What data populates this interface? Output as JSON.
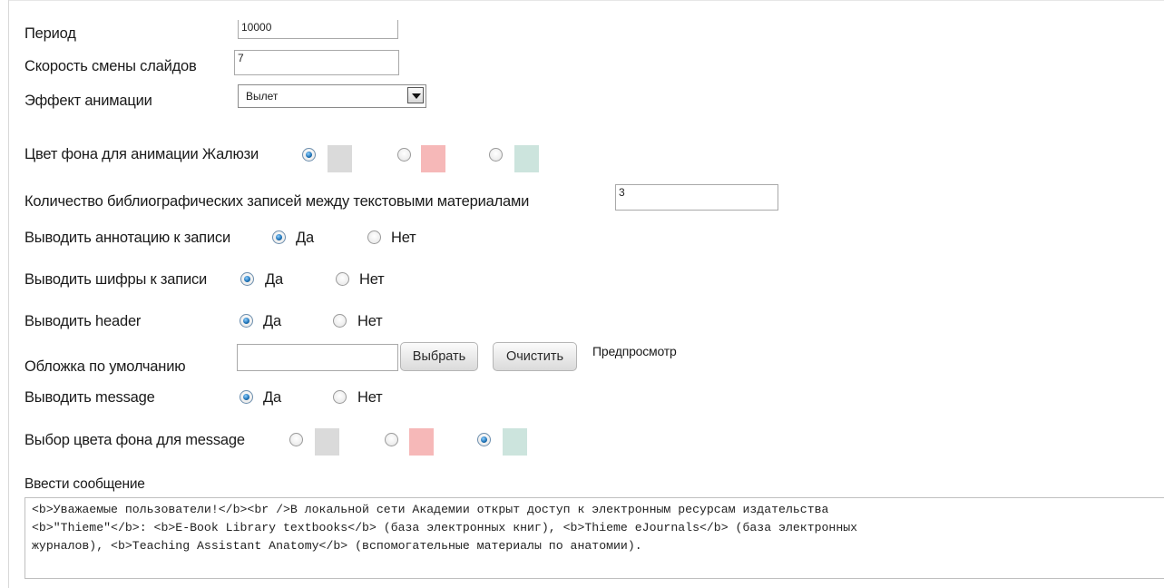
{
  "form": {
    "period": {
      "label": "Период",
      "value": "10000"
    },
    "slide_speed": {
      "label": "Скорость смены слайдов",
      "value": "7"
    },
    "animation_effect": {
      "label": "Эффект анимации",
      "selected": "Вылет"
    },
    "animation_bg": {
      "label": "Цвет фона для анимации Жалюзи",
      "options": [
        {
          "color": "#dadada",
          "selected": true
        },
        {
          "color": "#f6b8b8",
          "selected": false
        },
        {
          "color": "#cce4dd",
          "selected": false
        }
      ]
    },
    "biblio_count": {
      "label": "Количество библиографических записей между текстовыми материалами",
      "value": "3"
    },
    "show_annotation": {
      "label": "Выводить аннотацию к записи",
      "yes": "Да",
      "no": "Нет",
      "selected": "yes"
    },
    "show_ciphers": {
      "label": "Выводить шифры к записи",
      "yes": "Да",
      "no": "Нет",
      "selected": "yes"
    },
    "show_header": {
      "label": "Выводить header",
      "yes": "Да",
      "no": "Нет",
      "selected": "yes"
    },
    "default_cover": {
      "label": "Обложка по умолчанию",
      "value": "",
      "choose_button": "Выбрать",
      "clear_button": "Очистить",
      "preview": "Предпросмотр"
    },
    "show_message": {
      "label": "Выводить message",
      "yes": "Да",
      "no": "Нет",
      "selected": "yes"
    },
    "message_bg": {
      "label": "Выбор цвета фона для message",
      "options": [
        {
          "color": "#dadada",
          "selected": false
        },
        {
          "color": "#f6b8b8",
          "selected": false
        },
        {
          "color": "#cce4dd",
          "selected": true
        }
      ]
    },
    "message": {
      "label": "Ввести сообщение",
      "lines": [
        "<b>Уважаемые пользователи!</b><br />В локальной сети Академии открыт доступ к электронным ресурсам издательства",
        "<b>\"Thieme\"</b>: <b>E-Book Library textbooks</b> (база электронных книг), <b>Thieme eJournals</b> (база электронных",
        "журналов), <b>Teaching Assistant Anatomy</b> (вспомогательные материалы по анатомии)."
      ]
    }
  }
}
